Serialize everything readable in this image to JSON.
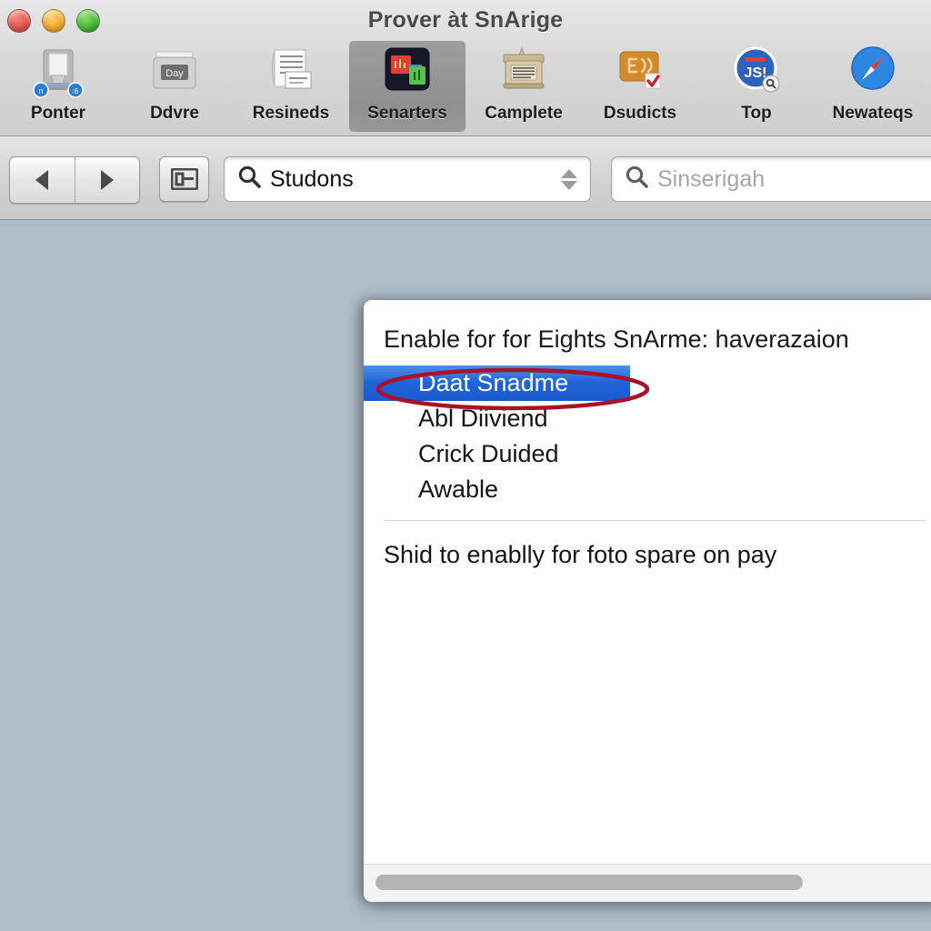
{
  "window": {
    "title": "Prover àt SnArige",
    "controls": [
      {
        "name": "close",
        "color": "#e4584e"
      },
      {
        "name": "minimize",
        "color": "#f2ad33"
      },
      {
        "name": "maximize",
        "color": "#4cb93b"
      }
    ]
  },
  "toolbar": {
    "items": [
      {
        "label": "Ponter",
        "icon": "printer-icon",
        "selected": false
      },
      {
        "label": "Ddvre",
        "icon": "disk-drive-icon",
        "selected": false
      },
      {
        "label": "Resineds",
        "icon": "documents-icon",
        "selected": false
      },
      {
        "label": "Senarters",
        "icon": "app-windows-icon",
        "selected": true
      },
      {
        "label": "Camplete",
        "icon": "keyboard-case-icon",
        "selected": false
      },
      {
        "label": "Dsudicts",
        "icon": "chalkboard-icon",
        "selected": false
      },
      {
        "label": "Top",
        "icon": "js-debugger-icon",
        "selected": false
      },
      {
        "label": "Newateqs",
        "icon": "safari-compass-icon",
        "selected": false
      }
    ]
  },
  "subbar": {
    "back_label": "Back",
    "forward_label": "Forward",
    "sidebar_toggle_label": "Toggle Sidebar",
    "primary_field": {
      "value": "Studons",
      "icon": "search-icon",
      "stepper": "stepper-arrows"
    },
    "secondary_field": {
      "placeholder": "Sinserigah",
      "icon": "search-icon"
    }
  },
  "panel": {
    "header": "Enable for for Eights SnArme: haverazaion",
    "items": [
      {
        "label": "Daat Snadme",
        "selected": true
      },
      {
        "label": "Abl Diiviend",
        "selected": false
      },
      {
        "label": "Crick Duided",
        "selected": false
      },
      {
        "label": "Awable",
        "selected": false
      }
    ],
    "footer": "Shid to enablly for foto spare on pay",
    "scrollbar": "horizontal-scrollbar"
  },
  "annotation": {
    "shape": "red-ellipse-highlight",
    "color": "#a8112a",
    "target": "Daat Snadme"
  },
  "colors": {
    "content_background": "#aebdca",
    "selection_blue": "#1f63d6",
    "annotation_red": "#a8112a",
    "toolbar_gray": "#d8d8d8"
  }
}
